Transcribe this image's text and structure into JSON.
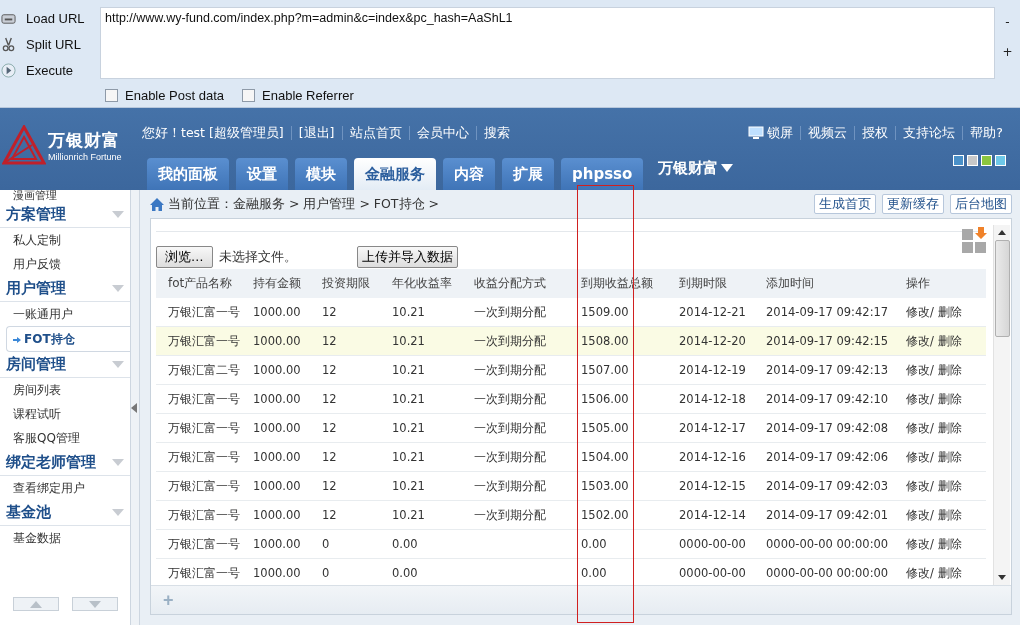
{
  "hackbar": {
    "actions": [
      {
        "label": "Load URL",
        "kind": "load"
      },
      {
        "label": "Split URL",
        "kind": "split"
      },
      {
        "label": "Execute",
        "kind": "execute"
      }
    ],
    "url": "http://www.wy-fund.com/index.php?m=admin&c=index&pc_hash=AaShL1",
    "side_marks": [
      "-",
      "+"
    ],
    "options": [
      {
        "label": "Enable Post data",
        "checked": false
      },
      {
        "label": "Enable Referrer",
        "checked": false
      }
    ]
  },
  "header": {
    "logo": {
      "name": "万银财富",
      "subtitle": "Millionrich Fortune"
    },
    "top_links": [
      "您好！test [超级管理员]",
      "[退出]",
      "站点首页",
      "会员中心",
      "搜索"
    ],
    "right_links": [
      "锁屏",
      "视频云",
      "授权",
      "支持论坛",
      "帮助?"
    ],
    "tabs": [
      {
        "label": "我的面板",
        "selected": false
      },
      {
        "label": "设置",
        "selected": false
      },
      {
        "label": "模块",
        "selected": false
      },
      {
        "label": "金融服务",
        "selected": true
      },
      {
        "label": "内容",
        "selected": false
      },
      {
        "label": "扩展",
        "selected": false
      },
      {
        "label": "phpsso",
        "selected": false
      }
    ],
    "site_menu": "万银财富",
    "themes": [
      {
        "color": "#4a90c8"
      },
      {
        "color": "#c8c8c8"
      },
      {
        "color": "#8cc63f"
      },
      {
        "color": "#6ec8e8"
      }
    ]
  },
  "sidebar": {
    "groups": [
      {
        "items": [
          {
            "label": "漫画管理",
            "selected": false
          }
        ]
      },
      {
        "title": "方案管理",
        "items": [
          {
            "label": "私人定制",
            "selected": false
          },
          {
            "label": "用户反馈",
            "selected": false
          }
        ]
      },
      {
        "title": "用户管理",
        "items": [
          {
            "label": "一账通用户",
            "selected": false
          },
          {
            "label": "FOT持仓",
            "selected": true
          }
        ]
      },
      {
        "title": "房间管理",
        "items": [
          {
            "label": "房间列表",
            "selected": false
          },
          {
            "label": "课程试听",
            "selected": false
          },
          {
            "label": "客服QQ管理",
            "selected": false
          }
        ]
      },
      {
        "title": "绑定老师管理",
        "items": [
          {
            "label": "查看绑定用户",
            "selected": false
          }
        ]
      },
      {
        "title": "基金池",
        "items": [
          {
            "label": "基金数据",
            "selected": false
          }
        ]
      }
    ]
  },
  "breadcrumb": "当前位置：金融服务 > 用户管理 > FOT持仓 >",
  "page_actions": [
    "生成首页",
    "更新缓存",
    "后台地图"
  ],
  "upload": {
    "browse": "浏览…",
    "status": "未选择文件。",
    "submit": "上传并导入数据"
  },
  "table": {
    "columns": [
      "fot产品名称",
      "持有金额",
      "投资期限",
      "年化收益率",
      "收益分配方式",
      "到期收益总额",
      "到期时限",
      "添加时间",
      "操作"
    ],
    "rows": [
      {
        "selected": false,
        "name": "万银汇富一号",
        "amount": "1000.00",
        "term": "12",
        "rate": "10.21",
        "method": "一次到期分配",
        "total": "1509.00",
        "due": "2014-12-21",
        "added": "2014-09-17 09:42:17",
        "edit": "修改/",
        "delete": "删除"
      },
      {
        "selected": true,
        "name": "万银汇富一号",
        "amount": "1000.00",
        "term": "12",
        "rate": "10.21",
        "method": "一次到期分配",
        "total": "1508.00",
        "due": "2014-12-20",
        "added": "2014-09-17 09:42:15",
        "edit": "修改/",
        "delete": "删除"
      },
      {
        "selected": false,
        "name": "万银汇富二号",
        "amount": "1000.00",
        "term": "12",
        "rate": "10.21",
        "method": "一次到期分配",
        "total": "1507.00",
        "due": "2014-12-19",
        "added": "2014-09-17 09:42:13",
        "edit": "修改/",
        "delete": "删除"
      },
      {
        "selected": false,
        "name": "万银汇富一号",
        "amount": "1000.00",
        "term": "12",
        "rate": "10.21",
        "method": "一次到期分配",
        "total": "1506.00",
        "due": "2014-12-18",
        "added": "2014-09-17 09:42:10",
        "edit": "修改/",
        "delete": "删除"
      },
      {
        "selected": false,
        "name": "万银汇富一号",
        "amount": "1000.00",
        "term": "12",
        "rate": "10.21",
        "method": "一次到期分配",
        "total": "1505.00",
        "due": "2014-12-17",
        "added": "2014-09-17 09:42:08",
        "edit": "修改/",
        "delete": "删除"
      },
      {
        "selected": false,
        "name": "万银汇富一号",
        "amount": "1000.00",
        "term": "12",
        "rate": "10.21",
        "method": "一次到期分配",
        "total": "1504.00",
        "due": "2014-12-16",
        "added": "2014-09-17 09:42:06",
        "edit": "修改/",
        "delete": "删除"
      },
      {
        "selected": false,
        "name": "万银汇富一号",
        "amount": "1000.00",
        "term": "12",
        "rate": "10.21",
        "method": "一次到期分配",
        "total": "1503.00",
        "due": "2014-12-15",
        "added": "2014-09-17 09:42:03",
        "edit": "修改/",
        "delete": "删除"
      },
      {
        "selected": false,
        "name": "万银汇富一号",
        "amount": "1000.00",
        "term": "12",
        "rate": "10.21",
        "method": "一次到期分配",
        "total": "1502.00",
        "due": "2014-12-14",
        "added": "2014-09-17 09:42:01",
        "edit": "修改/",
        "delete": "删除"
      },
      {
        "selected": false,
        "name": "万银汇富一号",
        "amount": "1000.00",
        "term": "0",
        "rate": "0.00",
        "total": "0.00",
        "due": "0000-00-00",
        "added": "0000-00-00 00:00:00",
        "edit": "修改/",
        "delete": "删除"
      },
      {
        "selected": false,
        "name": "万银汇富一号",
        "amount": "1000.00",
        "term": "0",
        "rate": "0.00",
        "total": "0.00",
        "due": "0000-00-00",
        "added": "0000-00-00 00:00:00",
        "edit": "修改/",
        "delete": "删除"
      }
    ]
  },
  "footer_add": "+"
}
